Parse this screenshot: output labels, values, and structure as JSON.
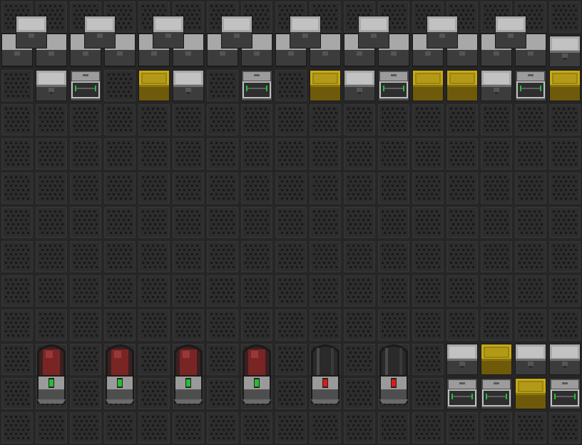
{
  "view": {
    "kind": "top-down tile map",
    "tile_columns": 17,
    "tile_rows": 13
  },
  "palette": {
    "background": "#1f1f1f",
    "floor": "#333333",
    "floor_edge": "#262626",
    "floor_dot": "#181818",
    "metal_light": "#a8a8a8",
    "metal_mid": "#6e6e6e",
    "metal_dark": "#3c3c3c",
    "yellow_light": "#c7a816",
    "yellow_dark": "#6e5a0a",
    "pod_red": "#7a2525",
    "pod_glass": "#2a2a2a",
    "led_green": "#22c033",
    "led_red": "#e01818"
  },
  "objects": {
    "double_locker_columns": [
      0,
      2,
      4,
      6,
      8,
      10,
      12,
      14
    ],
    "corner_locker_columns": [
      16
    ],
    "row1_tiles": [
      {
        "col": 1,
        "type": "grey"
      },
      {
        "col": 2,
        "type": "rack"
      },
      {
        "col": 4,
        "type": "yellow"
      },
      {
        "col": 5,
        "type": "grey"
      },
      {
        "col": 7,
        "type": "rack"
      },
      {
        "col": 9,
        "type": "yellow"
      },
      {
        "col": 10,
        "type": "grey"
      },
      {
        "col": 11,
        "type": "rack"
      },
      {
        "col": 12,
        "type": "yellow"
      },
      {
        "col": 13,
        "type": "yellow"
      },
      {
        "col": 14,
        "type": "grey"
      },
      {
        "col": 15,
        "type": "rack"
      },
      {
        "col": 16,
        "type": "yellow"
      }
    ],
    "pods": [
      {
        "col": 1,
        "state": "occupied",
        "led": "green"
      },
      {
        "col": 3,
        "state": "occupied",
        "led": "green"
      },
      {
        "col": 5,
        "state": "occupied",
        "led": "green"
      },
      {
        "col": 7,
        "state": "occupied",
        "led": "green"
      },
      {
        "col": 9,
        "state": "empty",
        "led": "red"
      },
      {
        "col": 11,
        "state": "empty",
        "led": "red"
      }
    ],
    "lower_crates": [
      {
        "col": 13,
        "row": 10,
        "type": "grey"
      },
      {
        "col": 14,
        "row": 10,
        "type": "yellow"
      },
      {
        "col": 15,
        "row": 10,
        "type": "grey"
      },
      {
        "col": 16,
        "row": 10,
        "type": "grey"
      },
      {
        "col": 13,
        "row": 11,
        "type": "rack"
      },
      {
        "col": 14,
        "row": 11,
        "type": "rack"
      },
      {
        "col": 15,
        "row": 11,
        "type": "yellow"
      },
      {
        "col": 16,
        "row": 11,
        "type": "rack"
      }
    ]
  }
}
